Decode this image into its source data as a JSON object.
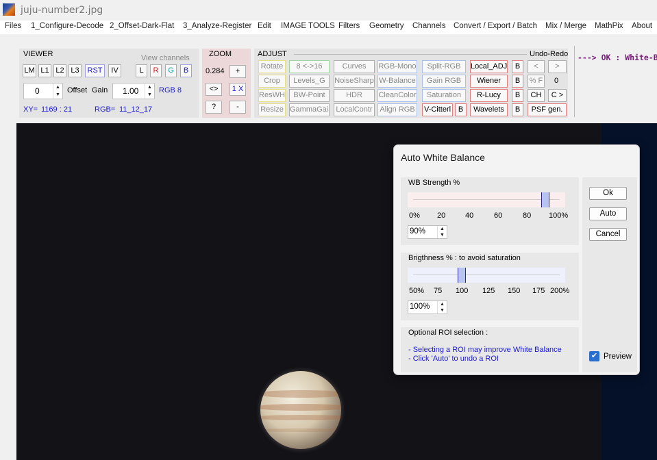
{
  "window": {
    "title": "juju-number2.jpg"
  },
  "menu": [
    "Files",
    "1_Configure-Decode",
    "2_Offset-Dark-Flat",
    "3_Analyze-Register",
    "Edit",
    "IMAGE TOOLS",
    "Filters",
    "Geometry",
    "Channels",
    "Convert / Export / Batch",
    "Mix / Merge",
    "MathPix",
    "About"
  ],
  "viewer": {
    "label": "VIEWER",
    "view_channels_label": "View channels",
    "buttons": [
      "LM",
      "L1",
      "L2",
      "L3",
      "RST",
      "IV"
    ],
    "channels": [
      "L",
      "R",
      "G",
      "B"
    ],
    "offset_value": "0",
    "offset_label": "Offset",
    "gain_label": "Gain",
    "gain_value": "1.00",
    "mode": "RGB 8",
    "xy_label": "XY=",
    "xy_value": "1169 : 21",
    "rgb_label": "RGB=",
    "rgb_value": "11_12_17"
  },
  "zoom": {
    "label": "ZOOM",
    "value": "0.284",
    "plus": "+",
    "fit": "<>",
    "one_x": "1 X",
    "help": "?",
    "minus": "-"
  },
  "adjust": {
    "label": "ADJUST",
    "undo_redo_label": "Undo-Redo",
    "row1": [
      "Rotate",
      "8 <->16",
      "Curves",
      "RGB-Mono",
      "Split-RGB",
      "Local_ADJ",
      "B"
    ],
    "row2": [
      "Crop",
      "Levels_G",
      "NoiseSharp",
      "W-Balance",
      "Gain RGB",
      "Wiener",
      "B"
    ],
    "row3": [
      "ResWH",
      "BW-Point",
      "HDR",
      "CleanColor",
      "Saturation",
      "R-Lucy",
      "B"
    ],
    "row4": [
      "Resize",
      "GammaGain",
      "LocalContr",
      "Align RGB",
      "V-Citterl",
      "B",
      "Wavelets",
      "B",
      "PSF gen."
    ],
    "undo": "<",
    "redo": ">",
    "percent_f": "% F",
    "count": "0",
    "ch": "CH",
    "c_gt": "C >"
  },
  "status_text": "---> OK :  White-Bal",
  "dialog": {
    "title": "Auto White Balance",
    "wb_label": "WB Strength %",
    "wb_ticks": [
      "0%",
      "20",
      "40",
      "60",
      "80",
      "100%"
    ],
    "wb_value": "90%",
    "wb_percent": 90,
    "brightness_label": "Brigthness %  :  to avoid saturation",
    "brightness_ticks": [
      "50%",
      "75",
      "100",
      "125",
      "150",
      "175",
      "200%"
    ],
    "brightness_value": "100%",
    "brightness_percent": 100,
    "roi_label": "Optional ROI selection :",
    "roi_line1": "- Selecting a ROI may improve White Balance",
    "roi_line2": "- Click 'Auto' to undo a ROI",
    "ok": "Ok",
    "auto": "Auto",
    "cancel": "Cancel",
    "preview_label": "Preview",
    "preview_checked": true
  }
}
